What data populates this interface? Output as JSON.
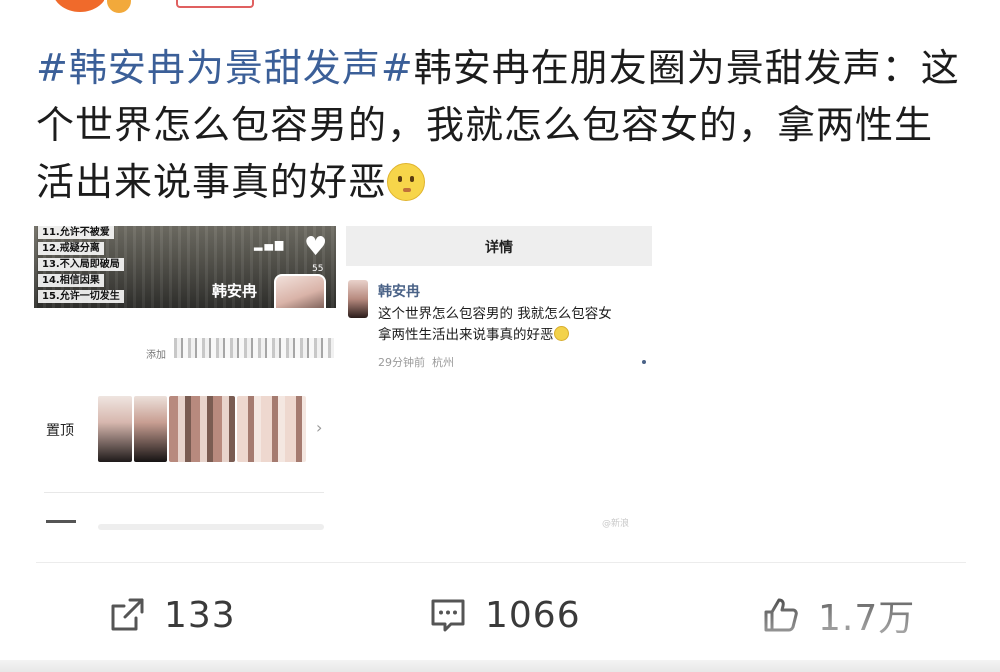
{
  "post": {
    "hashtag": "#韩安冉为景甜发声#",
    "text": "韩安冉在朋友圈为景甜发声：这个世界怎么包容男的，我就怎么包容女的，拿两性生活出来说事真的好恶",
    "emoji": "pensive-face-emoji"
  },
  "left_screenshot": {
    "rules": [
      "11.允许不被爱",
      "12.戒疑分离",
      "13.不入局即破局",
      "14.相信因果",
      "15.允许一切发生"
    ],
    "like_count": "55",
    "name": "韩安冉",
    "add_text": "添加",
    "pinned_label": "置顶"
  },
  "right_screenshot": {
    "header_title": "详情",
    "name": "韩安冉",
    "body": "这个世界怎么包容男的 我就怎么包容女\n拿两性生活出来说事真的好恶",
    "time": "29分钟前",
    "location": "杭州",
    "watermark": "@新浪"
  },
  "actions": {
    "share_count": "133",
    "comment_count": "1066",
    "like_count": "1.7万"
  },
  "colors": {
    "hashtag": "#3b5f98",
    "name_blue": "#4a6287",
    "text": "#1c1c1c"
  }
}
